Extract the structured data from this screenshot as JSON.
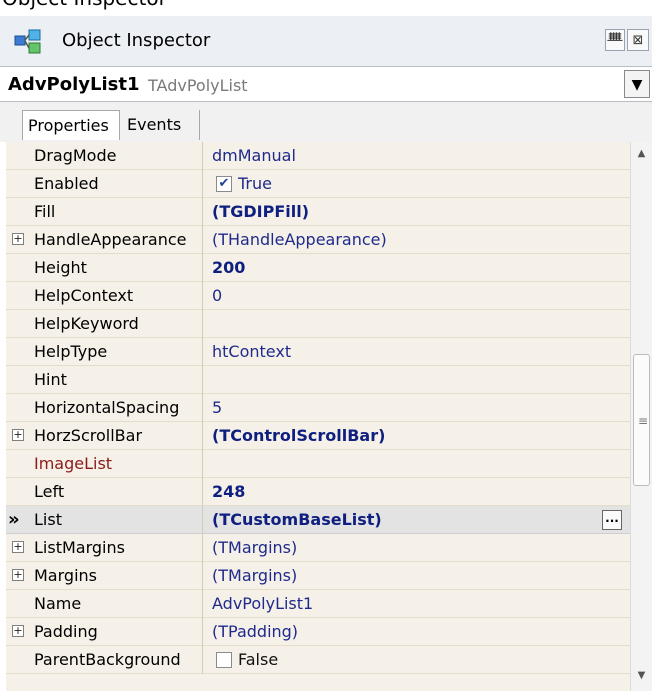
{
  "top_strip_text": "Object Inspector",
  "window": {
    "title": "Object Inspector",
    "pin_glyph": "ᚙ",
    "close_glyph": "⊠"
  },
  "object_selector": {
    "name": "AdvPolyList1",
    "type": "TAdvPolyList",
    "dropdown_glyph": "▼"
  },
  "tabs": [
    {
      "label": "Properties",
      "active": true
    },
    {
      "label": "Events",
      "active": false
    }
  ],
  "properties": [
    {
      "name": "DragMode",
      "value": "dmManual",
      "style": "normal"
    },
    {
      "name": "Enabled",
      "value": "True",
      "checkbox": true,
      "checked": true
    },
    {
      "name": "Fill",
      "value": "(TGDIPFill)",
      "style": "bold"
    },
    {
      "name": "HandleAppearance",
      "value": "(THandleAppearance)",
      "expandable": true
    },
    {
      "name": "Height",
      "value": "200",
      "style": "bold"
    },
    {
      "name": "HelpContext",
      "value": "0",
      "style": "normal"
    },
    {
      "name": "HelpKeyword",
      "value": "",
      "style": "normal"
    },
    {
      "name": "HelpType",
      "value": "htContext",
      "style": "normal"
    },
    {
      "name": "Hint",
      "value": "",
      "style": "normal"
    },
    {
      "name": "HorizontalSpacing",
      "value": "5",
      "style": "normal"
    },
    {
      "name": "HorzScrollBar",
      "value": "(TControlScrollBar)",
      "style": "bold",
      "expandable": true
    },
    {
      "name": "ImageList",
      "value": "",
      "name_color": "red"
    },
    {
      "name": "Left",
      "value": "248",
      "style": "bold"
    },
    {
      "name": "List",
      "value": "(TCustomBaseList)",
      "style": "bold",
      "selected": true,
      "has_ellipsis": true
    },
    {
      "name": "ListMargins",
      "value": "(TMargins)",
      "expandable": true
    },
    {
      "name": "Margins",
      "value": "(TMargins)",
      "expandable": true
    },
    {
      "name": "Name",
      "value": "AdvPolyList1",
      "style": "normal"
    },
    {
      "name": "Padding",
      "value": "(TPadding)",
      "expandable": true
    },
    {
      "name": "ParentBackground",
      "value": "False",
      "checkbox": true,
      "checked": false
    }
  ],
  "selected_marker": "»",
  "ellipsis_label": "...",
  "colors": {
    "value_blue": "#1f2a8c",
    "name_red": "#8b1a1a",
    "grid_bg": "#f5f1e8",
    "titlebar_bg": "#eceff4"
  }
}
